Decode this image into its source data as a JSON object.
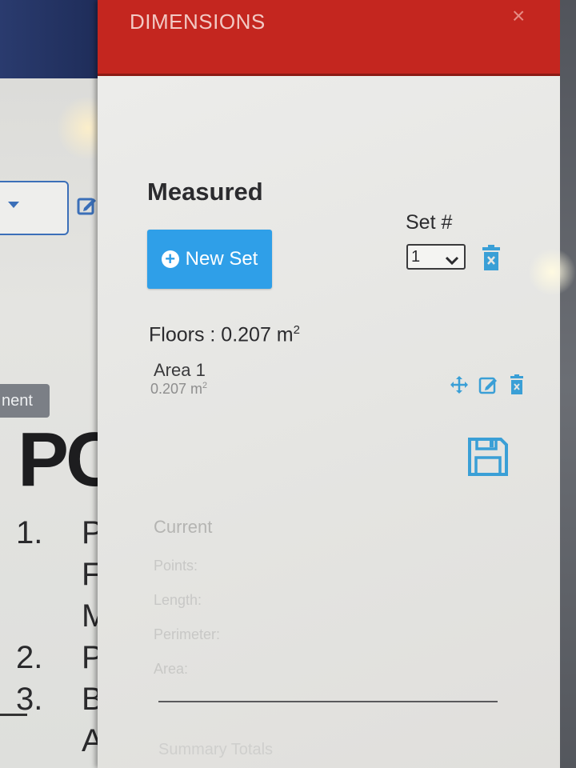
{
  "background_app": {
    "chip_label": "nent",
    "big_text": "PC",
    "list": [
      {
        "num": "1.",
        "txt": "P"
      },
      {
        "num": "",
        "txt": "F"
      },
      {
        "num": "",
        "txt": "M"
      },
      {
        "num": "2.",
        "txt": "P"
      },
      {
        "num": "3.",
        "txt": "B"
      },
      {
        "num": "",
        "txt": "A"
      }
    ]
  },
  "panel": {
    "title": "DIMENSIONS",
    "close_glyph": "×",
    "measured_heading": "Measured",
    "new_set_label": "New Set",
    "set_label": "Set #",
    "set_value": "1",
    "floors_label": "Floors : 0.207 m",
    "floors_unit_exp": "2",
    "area_name": "Area 1",
    "area_value": "0.207 m",
    "area_unit_exp": "2",
    "current_heading": "Current",
    "stats": {
      "points": "Points:",
      "length": "Length:",
      "perimeter": "Perimeter:",
      "area": "Area:"
    },
    "summary_heading": "Summary Totals"
  },
  "colors": {
    "header_red": "#c4261f",
    "button_blue": "#2f9fe8",
    "icon_blue": "#3a9fd6"
  },
  "icons": {
    "set_delete": "trash-icon",
    "area_move": "move-icon",
    "area_edit": "edit-icon",
    "area_delete": "trash-icon",
    "save": "floppy-disk-icon",
    "new_set": "plus-circle-icon"
  }
}
